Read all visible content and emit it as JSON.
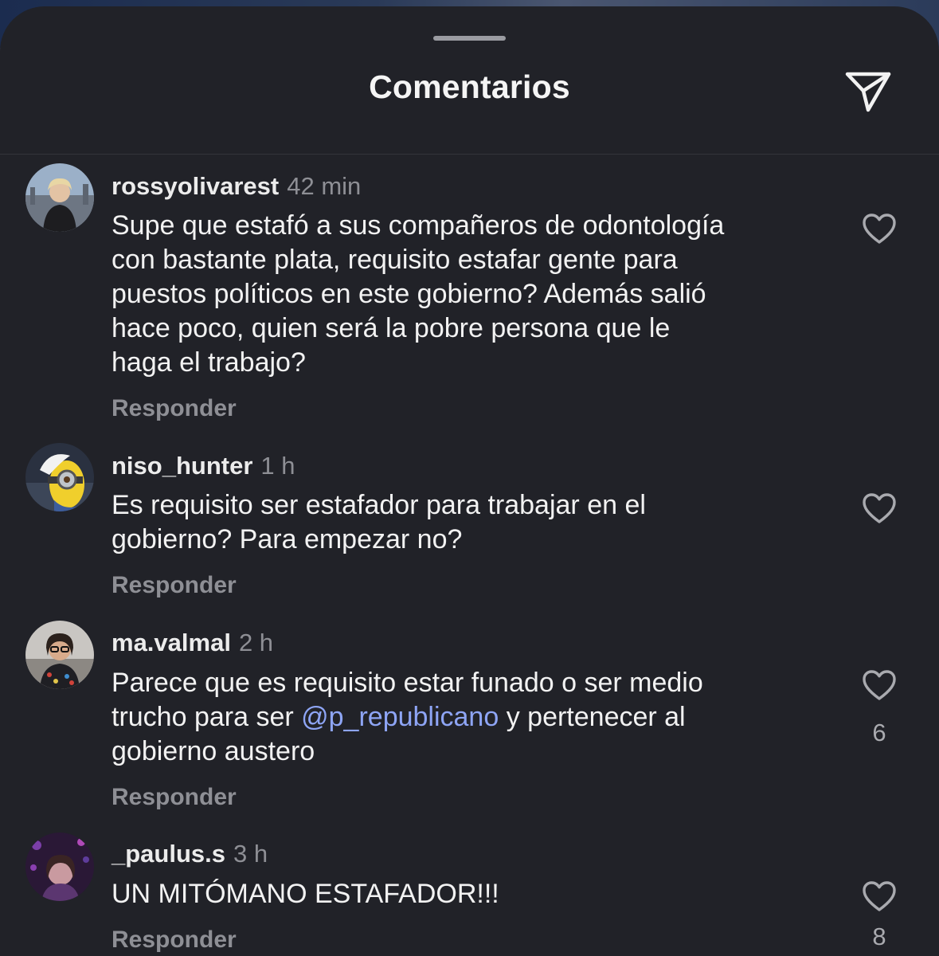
{
  "header": {
    "title": "Comentarios"
  },
  "comments": [
    {
      "username": "rossyolivarest",
      "time": "42 min",
      "lines": [
        "Supe que estafó a sus compañeros de odontología",
        "con bastante plata, requisito estafar gente para",
        "puestos políticos en este gobierno? Además salió",
        "hace poco, quien será la pobre persona que le",
        "haga el trabajo?"
      ],
      "reply_label": "Responder"
    },
    {
      "username": "niso_hunter",
      "time": "1 h",
      "lines": [
        "Es requisito ser estafador para trabajar en el",
        "gobierno? Para empezar no?"
      ],
      "reply_label": "Responder"
    },
    {
      "username": "ma.valmal",
      "time": "2 h",
      "line1": "Parece que es requisito estar funado o ser medio",
      "line2_before": "trucho para ser ",
      "mention": "@p_republicano",
      "line2_after": " y pertenecer al",
      "line3": "gobierno austero",
      "reply_label": "Responder",
      "likes": "6"
    },
    {
      "username": "_paulus.s",
      "time": "3 h",
      "lines": [
        "UN MITÓMANO ESTAFADOR!!!"
      ],
      "reply_label": "Responder",
      "likes": "8"
    }
  ],
  "colors": {
    "sheet_background": "#212228",
    "primary_text": "#f2f2f2",
    "secondary_text": "#8e8f95",
    "mention": "#8ea5f5"
  },
  "icons": {
    "share": "paper-plane-icon",
    "like": "heart-outline-icon"
  }
}
